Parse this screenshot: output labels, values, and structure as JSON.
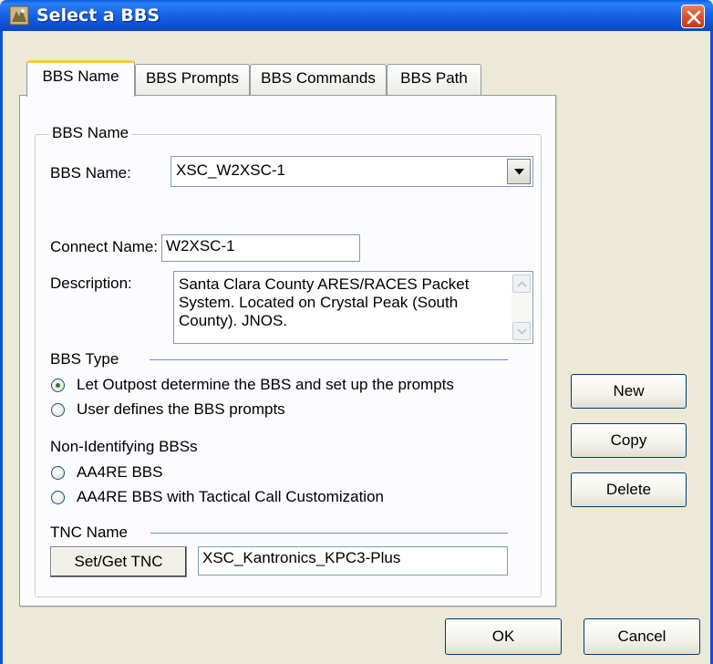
{
  "window": {
    "title": "Select a BBS"
  },
  "tabs": [
    {
      "label": "BBS Name",
      "active": true
    },
    {
      "label": "BBS Prompts",
      "active": false
    },
    {
      "label": "BBS Commands",
      "active": false
    },
    {
      "label": "BBS Path",
      "active": false
    }
  ],
  "group": {
    "legend": "BBS Name"
  },
  "fields": {
    "bbs_name_label": "BBS Name:",
    "bbs_name_value": "XSC_W2XSC-1",
    "connect_name_label": "Connect Name:",
    "connect_name_value": "W2XSC-1",
    "description_label": "Description:",
    "description_value": "Santa Clara County ARES/RACES Packet System.  Located on Crystal Peak (South County).  JNOS."
  },
  "bbs_type": {
    "heading": "BBS Type",
    "option_auto": "Let Outpost determine the BBS and set up the prompts",
    "option_user": "User defines the BBS prompts",
    "selected": "auto"
  },
  "non_identifying": {
    "heading": "Non-Identifying BBSs",
    "option_aa4re": "AA4RE BBS",
    "option_aa4re_tactical": "AA4RE BBS with Tactical Call Customization"
  },
  "tnc": {
    "heading": "TNC Name",
    "set_get_label": "Set/Get TNC",
    "value": "XSC_Kantronics_KPC3-Plus"
  },
  "side_buttons": {
    "new": "New",
    "copy": "Copy",
    "delete": "Delete"
  },
  "footer_buttons": {
    "ok": "OK",
    "cancel": "Cancel"
  },
  "colors": {
    "titlebar": "#0b52d6",
    "dialog_bg": "#ece9d8",
    "panel_bg": "#fcfcfe",
    "close_button": "#d9502c",
    "active_tab_accent": "#ffc83c",
    "section_line": "#6e8cd5"
  }
}
